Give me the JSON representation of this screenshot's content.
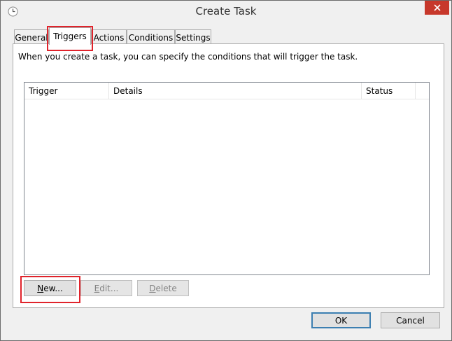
{
  "window": {
    "title": "Create Task",
    "icon": "clock-icon",
    "close_icon": "close-icon"
  },
  "tabs": [
    {
      "label": "General",
      "active": false
    },
    {
      "label": "Triggers",
      "active": true
    },
    {
      "label": "Actions",
      "active": false
    },
    {
      "label": "Conditions",
      "active": false
    },
    {
      "label": "Settings",
      "active": false
    }
  ],
  "triggers_panel": {
    "description": "When you create a task, you can specify the conditions that will trigger the task.",
    "columns": [
      "Trigger",
      "Details",
      "Status"
    ],
    "rows": [],
    "buttons": {
      "new_mnemonic": "N",
      "new_rest": "ew...",
      "edit_mnemonic": "E",
      "edit_rest": "dit...",
      "delete_mnemonic": "D",
      "delete_rest": "elete"
    }
  },
  "dialog_buttons": {
    "ok": "OK",
    "cancel": "Cancel"
  },
  "colors": {
    "close_button": "#c7382b",
    "highlight": "#e0232b",
    "default_button_border": "#3c7fb1"
  }
}
